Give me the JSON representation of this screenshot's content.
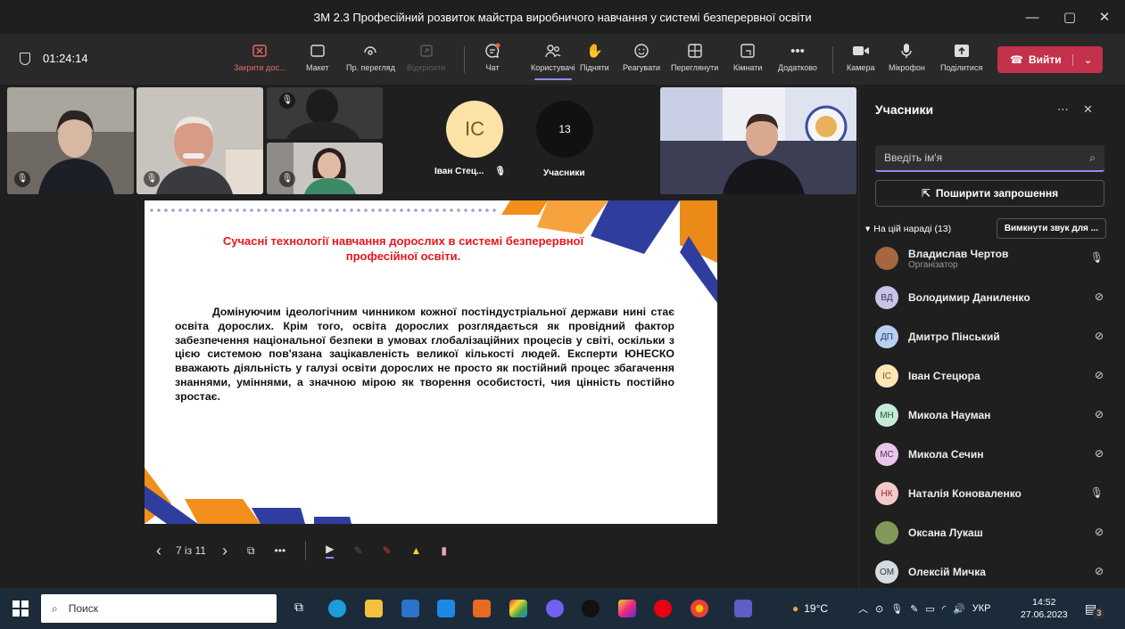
{
  "window": {
    "title": "ЗМ 2.3 Професійний розвиток майстра виробничого навчання у системі безперервної освіти",
    "minimize": "—",
    "maximize": "▢",
    "close": "✕"
  },
  "toolbar": {
    "timer": "01:24:14",
    "buttons": [
      {
        "label": "Закрити дос...",
        "icon": "x-box-icon"
      },
      {
        "label": "Макет",
        "icon": "layout-icon"
      },
      {
        "label": "Пр. перегляд",
        "icon": "eye-icon"
      },
      {
        "label": "Відкріпити",
        "icon": "unpin-icon"
      },
      {
        "label": "Чат",
        "icon": "chat-icon"
      },
      {
        "label": "Користувачі",
        "icon": "people-icon"
      },
      {
        "label": "Підняти",
        "icon": "hand-icon"
      },
      {
        "label": "Реагувати",
        "icon": "smile-icon"
      },
      {
        "label": "Переглянути",
        "icon": "grid-icon"
      },
      {
        "label": "Кімнати",
        "icon": "rooms-icon"
      },
      {
        "label": "Додатково",
        "icon": "more-icon"
      },
      {
        "label": "Камера",
        "icon": "camera-icon"
      },
      {
        "label": "Мікрофон",
        "icon": "mic-icon"
      },
      {
        "label": "Поділитися",
        "icon": "share-icon"
      }
    ],
    "leave_label": "Вийти"
  },
  "stage": {
    "avatar_initials": "ІС",
    "avatar_name": "Іван Стец...",
    "count_badge": "13",
    "count_label": "Учасники",
    "slide": {
      "heading": "Сучасні технології навчання дорослих в системі безперервної професійної освіти.",
      "body": "Домінуючим ідеологічним чинником кожної постіндустріальної держави нині стає освіта дорослих. Крім того, освіта дорослих розглядається як провідний фактор забезпечення національної безпеки в умовах глобалізаційних процесів у світі, оскільки з цією системою пов'язана зацікавленість великої кількості людей. Експерти ЮНЕСКО вважають діяльність у галузі освіти дорослих не просто як постійний процес збагачення знаннями, уміннями, а значною мірою як творення особистості, чия цінність постійно зростає."
    },
    "slide_counter": "7 із 11"
  },
  "panel": {
    "title": "Учасники",
    "search_placeholder": "Введіть ім'я",
    "invite_label": "Поширити запрошення",
    "section_label": "На цій нараді (13)",
    "mute_all_label": "Вимкнути звук для ...",
    "participants": [
      {
        "initials": "",
        "name": "Владислав Чертов",
        "role": "Організатор",
        "mic": "on",
        "color": "#a5673f"
      },
      {
        "initials": "ВД",
        "name": "Володимир Даниленко",
        "role": "",
        "mic": "off",
        "color": "#c9c3e6"
      },
      {
        "initials": "ДП",
        "name": "Дмитро Пінський",
        "role": "",
        "mic": "off",
        "color": "#b9cff0"
      },
      {
        "initials": "ІС",
        "name": "Іван Стецюра",
        "role": "",
        "mic": "off",
        "color": "#fbe6b8"
      },
      {
        "initials": "МН",
        "name": "Микола Науман",
        "role": "",
        "mic": "off",
        "color": "#c5ead5"
      },
      {
        "initials": "МС",
        "name": "Микола Сечин",
        "role": "",
        "mic": "off",
        "color": "#e7c8e8"
      },
      {
        "initials": "НК",
        "name": "Наталія Коноваленко",
        "role": "",
        "mic": "on",
        "color": "#f5c9c9"
      },
      {
        "initials": "",
        "name": "Оксана Лукаш",
        "role": "",
        "mic": "off",
        "color": "#7f9a58"
      },
      {
        "initials": "ОМ",
        "name": "Олексій Мичка",
        "role": "",
        "mic": "off",
        "color": "#d6dbe0"
      }
    ]
  },
  "taskbar": {
    "search_placeholder": "Поиск",
    "weather": "19°C",
    "language": "УКР",
    "time": "14:52",
    "date": "27.06.2023",
    "notifications": "3"
  }
}
